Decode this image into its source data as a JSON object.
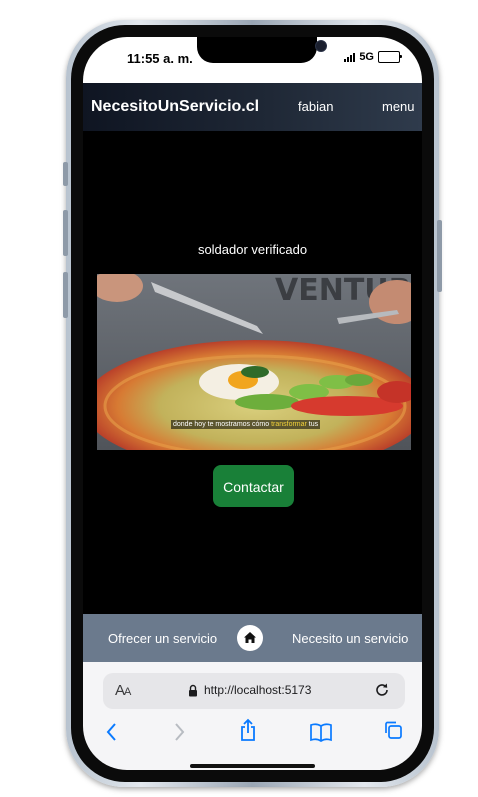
{
  "status_bar": {
    "time": "11:55 a. m.",
    "network": "5G"
  },
  "navbar": {
    "brand": "NecesitoUnServicio.cl",
    "user": "fabian",
    "menu": "menu"
  },
  "main": {
    "verified_label": "soldador verificado",
    "media_caption_before": "donde hoy te mostramos cómo ",
    "media_caption_highlight": "transformar",
    "media_caption_after": " tus",
    "contact_button": "Contactar"
  },
  "bottom_nav": {
    "offer": "Ofrecer un servicio",
    "need": "Necesito un servicio",
    "home_icon": "home-icon"
  },
  "browser": {
    "text_size_label": "A",
    "text_size_label_small": "A",
    "url": "http://localhost:5173",
    "icons": [
      "back-icon",
      "forward-icon",
      "share-icon",
      "bookmarks-icon",
      "tabs-icon"
    ]
  },
  "colors": {
    "navbar": "#1f2836",
    "contact_button": "#198038",
    "bottom_nav": "#6b7a8d",
    "browser_accent": "#0a7aff"
  }
}
